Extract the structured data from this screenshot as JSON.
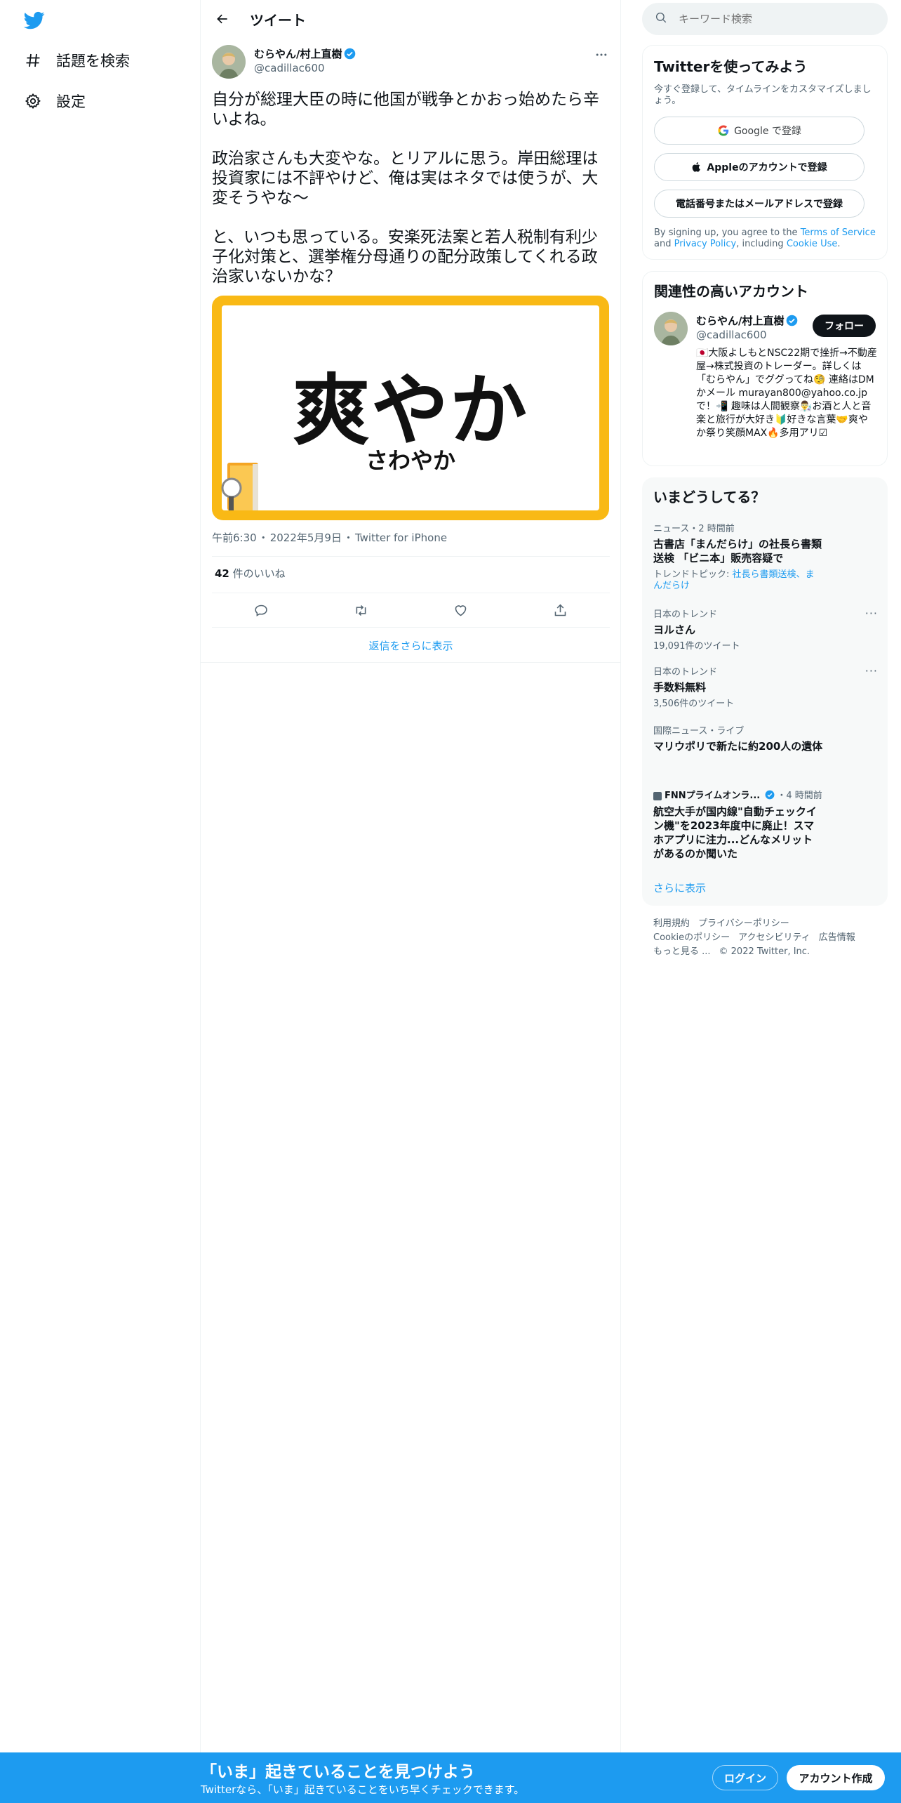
{
  "colors": {
    "accent": "#1d9bf0",
    "text": "#0f1419",
    "muted": "#536471",
    "media_border": "#f9b915"
  },
  "nav": {
    "items": [
      {
        "label": "話題を検索",
        "icon": "hashtag-icon"
      },
      {
        "label": "設定",
        "icon": "gear-icon"
      }
    ]
  },
  "header": {
    "title": "ツイート"
  },
  "tweet": {
    "author_name": "むらやん/村上直樹",
    "author_handle": "@cadillac600",
    "text": "自分が総理大臣の時に他国が戦争とかおっ始めたら辛いよね。\n\n政治家さんも大変やな。とリアルに思う。岸田総理は投資家には不評やけど、俺は実はネタでは使うが、大変そうやな〜\n\nと、いつも思っている。安楽死法案と若人税制有利少子化対策と、選挙権分母通りの配分政策してくれる政治家いないかな？",
    "media_big_text": "爽やか",
    "media_small_text": "さわやか",
    "time": "午前6:30",
    "date": "2022年5月9日",
    "source": "Twitter for iPhone",
    "likes_count": "42",
    "likes_label": " 件のいいね",
    "show_more_replies": "返信をさらに表示"
  },
  "search": {
    "placeholder": "キーワード検索"
  },
  "signup": {
    "title": "Twitterを使ってみよう",
    "subtitle": "今すぐ登録して、タイムラインをカスタマイズしましょう。",
    "google": "Google で登録",
    "apple": "Appleのアカウントで登録",
    "phone": "電話番号またはメールアドレスで登録",
    "legal_prefix": "By signing up, you agree to the ",
    "terms": "Terms of Service",
    "and": " and ",
    "privacy": "Privacy Policy",
    "including": ", including ",
    "cookie": "Cookie Use",
    "period": "."
  },
  "related": {
    "title": "関連性の高いアカウント",
    "name": "むらやん/村上直樹",
    "handle": "@cadillac600",
    "follow": "フォロー",
    "bio": "🇯🇵大阪よしもとNSC22期で挫折→不動産屋→株式投資のトレーダー。詳しくは「むらやん」でググってね🧐 連絡はDMかメール murayan800@yahoo.co.jp で！📲 趣味は人間観察👨‍🔬お酒と人と音楽と旅行が大好き🔰好きな言葉🤝爽やか祭り笑顔MAX🔥多用アリ☑"
  },
  "trends": {
    "title": "いまどうしてる？",
    "items": [
      {
        "cat": "ニュース・2 時間前",
        "title": "古書店「まんだらけ」の社長ら書類送検 「ビニ本」販売容疑で",
        "sub_prefix": "トレンドトピック: ",
        "sub_link": "社長ら書類送検、まんだらけ"
      },
      {
        "cat": "日本のトレンド",
        "title": "ヨルさん",
        "sub": "19,091件のツイート"
      },
      {
        "cat": "日本のトレンド",
        "title": "手数料無料",
        "sub": "3,506件のツイート"
      },
      {
        "cat": "国際ニュース・ライブ",
        "title": "マリウポリで新たに約200人の遺体"
      },
      {
        "cat_source": "FNNプライムオンラ...",
        "cat_time": "・4 時間前",
        "title": "航空大手が国内線\"自動チェックイン機\"を2023年度中に廃止！スマホアプリに注力...どんなメリットがあるのか聞いた"
      }
    ],
    "show_more": "さらに表示"
  },
  "footer": {
    "links": [
      "利用規約",
      "プライバシーポリシー",
      "Cookieのポリシー",
      "アクセシビリティ",
      "広告情報",
      "もっと見る ..."
    ],
    "copyright": "© 2022 Twitter, Inc."
  },
  "bottom": {
    "title": "「いま」起きていることを見つけよう",
    "subtitle": "Twitterなら、「いま」起きていることをいち早くチェックできます。",
    "login": "ログイン",
    "signup": "アカウント作成"
  }
}
